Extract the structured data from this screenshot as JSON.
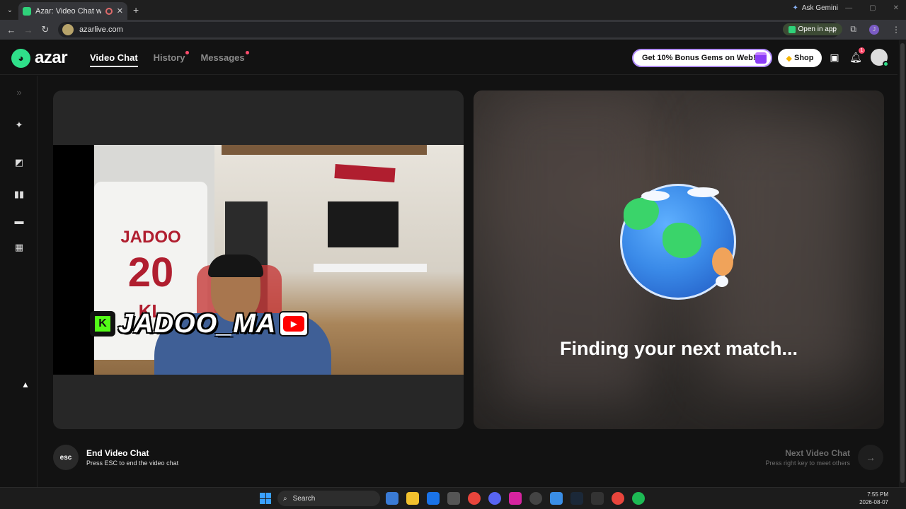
{
  "browser": {
    "tab_title": "Azar: Video Chat with New",
    "new_tab": "+",
    "ask_gemini": "Ask Gemini",
    "url": "azarlive.com",
    "open_in_app": "Open in app",
    "profile_initial": "J"
  },
  "header": {
    "logo_text": "azar",
    "nav": [
      {
        "label": "Video Chat",
        "active": true
      },
      {
        "label": "History",
        "dot": true
      },
      {
        "label": "Messages",
        "dot": true
      }
    ],
    "promo": "Get 10% Bonus Gems on Web!",
    "shop": "Shop",
    "notification_count": "1"
  },
  "local_video": {
    "jersey_name": "JADOO",
    "jersey_number": "20",
    "jersey_initials": "KL",
    "kick_letter": "K",
    "streamer_name": "JADOO_MA"
  },
  "remote_video": {
    "status": "Finding your next match..."
  },
  "footer": {
    "esc_label": "esc",
    "end_title": "End Video Chat",
    "end_sub": "Press ESC to end the video chat",
    "next_title": "Next Video Chat",
    "next_sub": "Press right key to meet others"
  },
  "taskbar": {
    "search_placeholder": "Search",
    "time": "7:55 PM",
    "date": "2026-08-07"
  },
  "colors": {
    "brand_green": "#2fe08a",
    "notification_red": "#ff4d6d",
    "background": "#121212"
  }
}
